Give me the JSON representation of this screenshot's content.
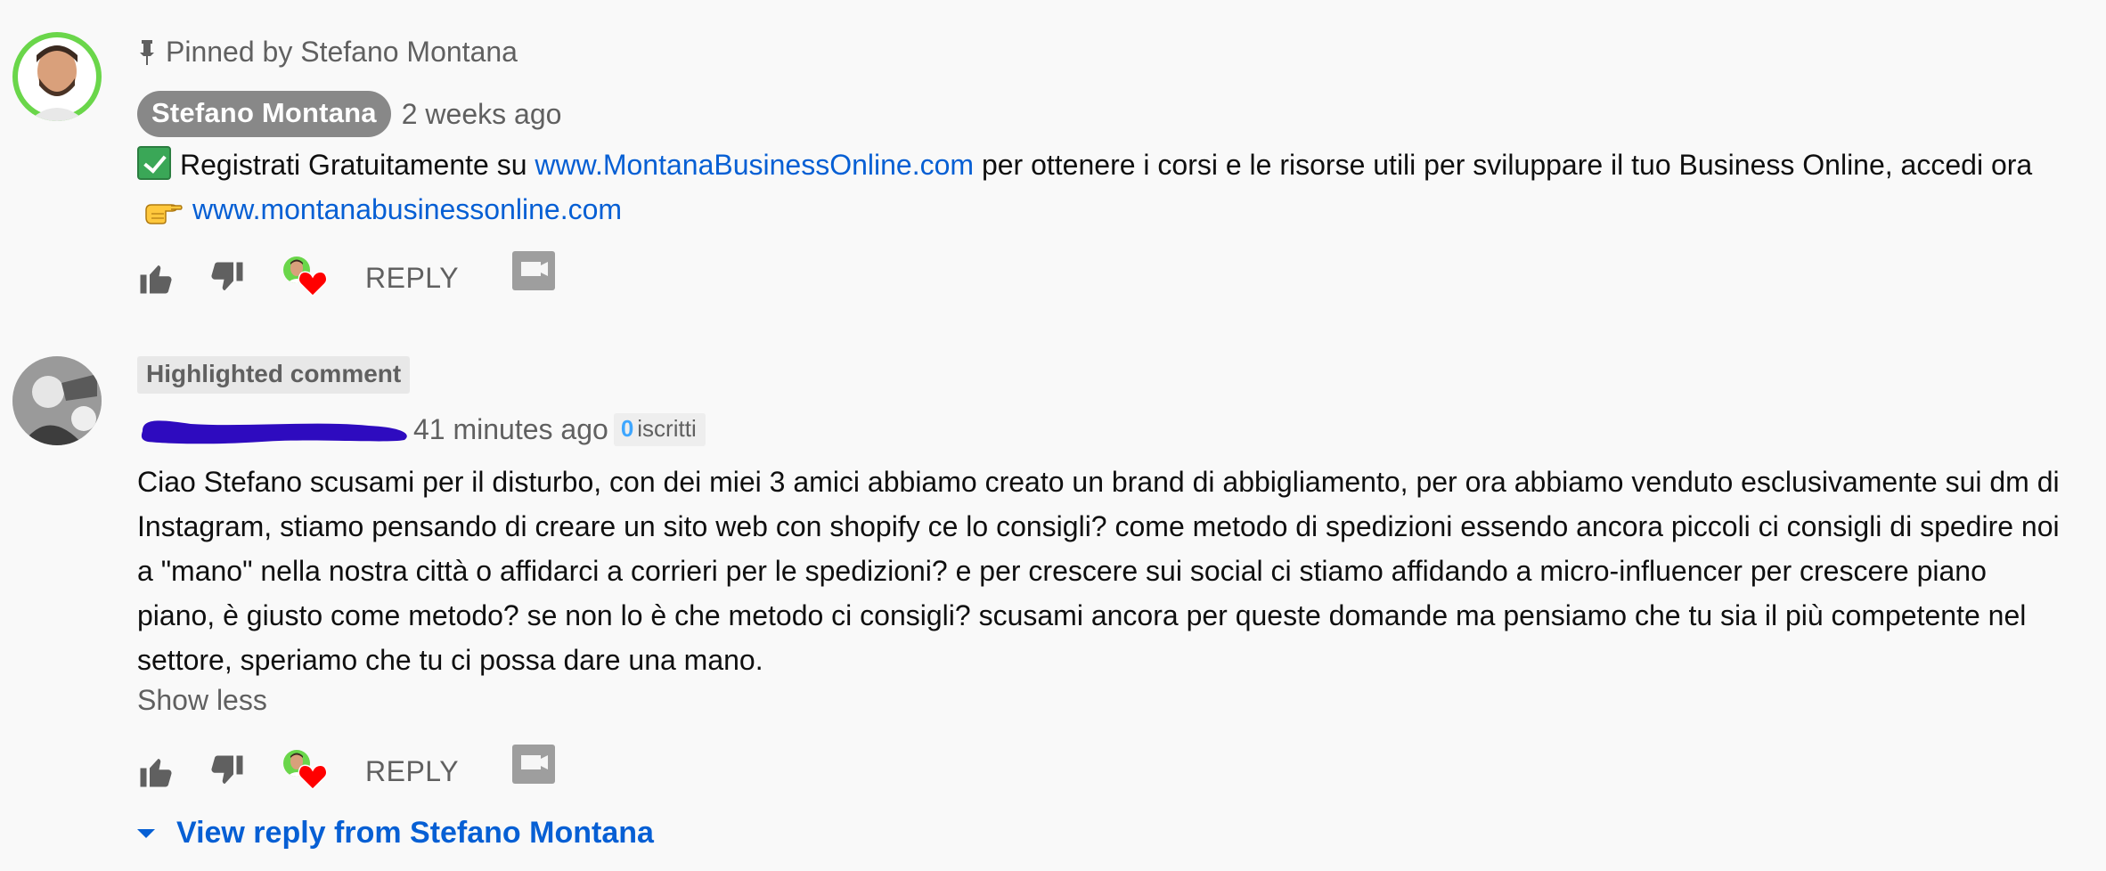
{
  "comments": [
    {
      "pinned_label": "Pinned by Stefano Montana",
      "author": "Stefano Montana",
      "time": "2 weeks ago",
      "text_parts": {
        "t1": "Registrati Gratuitamente su ",
        "link1": "www.MontanaBusinessOnline.com",
        "t2": " per ottenere i corsi e le risorse utili per sviluppare il tuo Business Online, accedi ora",
        "link2": "www.montanabusinessonline.com"
      },
      "reply_label": "REPLY",
      "avatar_color": "#6ad64a",
      "check_icon": "check-mark-button-icon",
      "hand_icon": "pointing-hand-icon"
    },
    {
      "highlight_label": "Highlighted comment",
      "author_redacted": true,
      "time": "41 minutes ago",
      "subscribers_count": "0",
      "subscribers_label": "iscritti",
      "text": "Ciao Stefano scusami per il disturbo, con dei miei 3 amici abbiamo creato un brand di abbigliamento, per ora abbiamo venduto esclusivamente sui dm di Instagram, stiamo pensando di creare un sito web con shopify ce lo consigli? come metodo di spedizioni essendo ancora piccoli ci consigli di spedire noi a \"mano\" nella nostra città o affidarci a corrieri per le spedizioni? e per crescere sui social ci stiamo affidando a micro-influencer per crescere piano piano, è giusto come metodo? se non lo è che metodo ci consigli? scusami ancora per queste domande ma pensiamo che tu sia il più competente nel settore, speriamo che tu ci possa dare una mano.",
      "show_less": "Show less",
      "reply_label": "REPLY",
      "view_reply": "View reply from Stefano Montana",
      "redaction_color": "#2e0bbf"
    }
  ],
  "colors": {
    "link": "#065fd4",
    "secondary_text": "#606060",
    "author_chip_bg": "#888888",
    "heart": "#ff0000"
  }
}
